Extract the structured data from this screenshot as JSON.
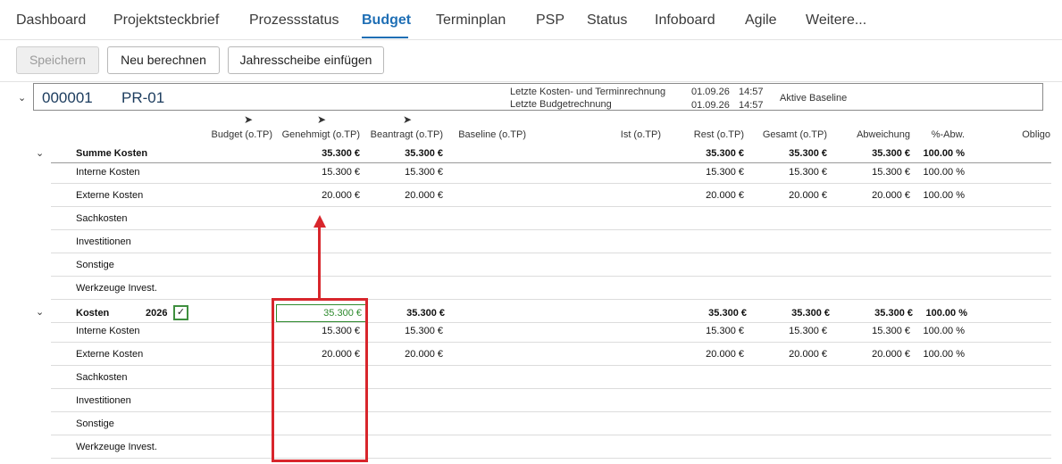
{
  "tabs": [
    {
      "label": "Dashboard"
    },
    {
      "label": "Projektsteckbrief"
    },
    {
      "label": "Prozessstatus"
    },
    {
      "label": "Budget"
    },
    {
      "label": "Terminplan"
    },
    {
      "label": "PSP"
    },
    {
      "label": "Status"
    },
    {
      "label": "Infoboard"
    },
    {
      "label": "Agile"
    },
    {
      "label": "Weitere..."
    }
  ],
  "active_tab": "Budget",
  "toolbar": {
    "save_label": "Speichern",
    "recalc_label": "Neu berechnen",
    "insert_year_label": "Jahresscheibe einfügen"
  },
  "project": {
    "number": "000001",
    "code": "PR-01",
    "last_cost_label": "Letzte Kosten- und Terminrechnung",
    "last_budget_label": "Letzte Budgetrechnung",
    "last_cost_date": "01.09.26",
    "last_cost_time": "14:57",
    "last_budget_date": "01.09.26",
    "last_budget_time": "14:57",
    "baseline_label": "Aktive Baseline"
  },
  "columns": {
    "budget": "Budget (o.TP)",
    "genehmigt": "Genehmigt (o.TP)",
    "beantragt": "Beantragt (o.TP)",
    "baseline": "Baseline (o.TP)",
    "ist": "Ist (o.TP)",
    "rest": "Rest (o.TP)",
    "gesamt": "Gesamt (o.TP)",
    "abweichung": "Abweichung",
    "pct": "%-Abw.",
    "obligo": "Obligo"
  },
  "summary": {
    "label": "Summe Kosten",
    "genehmigt": "35.300 €",
    "beantragt": "35.300 €",
    "rest": "35.300 €",
    "gesamt": "35.300 €",
    "abweichung": "35.300 €",
    "pct": "100.00 %",
    "rows": [
      {
        "label": "Interne Kosten",
        "genehmigt": "15.300 €",
        "beantragt": "15.300 €",
        "rest": "15.300 €",
        "gesamt": "15.300 €",
        "abweichung": "15.300 €",
        "pct": "100.00 %"
      },
      {
        "label": "Externe Kosten",
        "genehmigt": "20.000 €",
        "beantragt": "20.000 €",
        "rest": "20.000 €",
        "gesamt": "20.000 €",
        "abweichung": "20.000 €",
        "pct": "100.00 %"
      },
      {
        "label": "Sachkosten"
      },
      {
        "label": "Investitionen"
      },
      {
        "label": "Sonstige"
      },
      {
        "label": "Werkzeuge Invest."
      }
    ]
  },
  "year_group": {
    "label": "Kosten",
    "year": "2026",
    "check": "✓",
    "genehmigt": "35.300 €",
    "beantragt": "35.300 €",
    "rest": "35.300 €",
    "gesamt": "35.300 €",
    "abweichung": "35.300 €",
    "pct": "100.00 %",
    "rows": [
      {
        "label": "Interne Kosten",
        "genehmigt": "15.300 €",
        "beantragt": "15.300 €",
        "rest": "15.300 €",
        "gesamt": "15.300 €",
        "abweichung": "15.300 €",
        "pct": "100.00 %"
      },
      {
        "label": "Externe Kosten",
        "genehmigt": "20.000 €",
        "beantragt": "20.000 €",
        "rest": "20.000 €",
        "gesamt": "20.000 €",
        "abweichung": "20.000 €",
        "pct": "100.00 %"
      },
      {
        "label": "Sachkosten"
      },
      {
        "label": "Investitionen"
      },
      {
        "label": "Sonstige"
      },
      {
        "label": "Werkzeuge Invest."
      }
    ]
  },
  "colors": {
    "accent": "#1f6fb5",
    "edit_green": "#2e8b2e",
    "highlight_red": "#d8262c"
  },
  "icons": {
    "collapse": "chevron-down-icon",
    "filter": "filter-icon",
    "check": "check-icon"
  }
}
